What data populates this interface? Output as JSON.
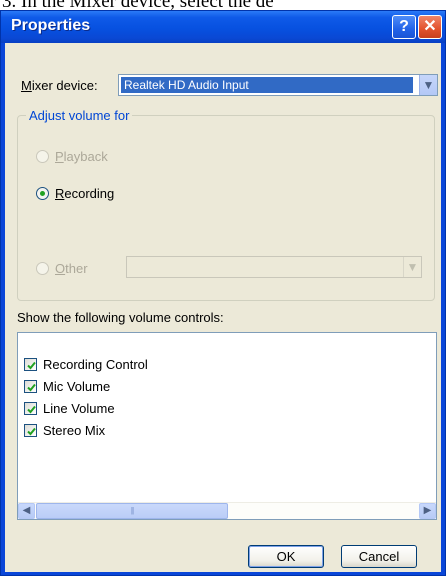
{
  "document": {
    "caption": "3. In the Mixer device, select the de"
  },
  "window": {
    "title": "Properties",
    "help_glyph": "?",
    "close_glyph": "✕"
  },
  "mixer": {
    "label_accel": "M",
    "label_rest": "ixer device:",
    "value": "Realtek HD Audio Input"
  },
  "adjust_group": {
    "legend": "Adjust volume for",
    "options": [
      {
        "accel": "P",
        "rest": "layback",
        "enabled": false,
        "selected": false
      },
      {
        "accel": "R",
        "rest": "ecording",
        "enabled": true,
        "selected": true
      },
      {
        "accel": "O",
        "rest": "ther",
        "enabled": false,
        "selected": false
      }
    ],
    "other_value": ""
  },
  "controls": {
    "label": "Show the following volume controls:",
    "items": [
      {
        "label": "Recording Control",
        "checked": true
      },
      {
        "label": "Mic Volume",
        "checked": true
      },
      {
        "label": "Line Volume",
        "checked": true
      },
      {
        "label": "Stereo Mix",
        "checked": true
      }
    ],
    "scrollbar": {
      "thumb_grip": "|||"
    }
  },
  "buttons": {
    "ok": "OK",
    "cancel": "Cancel"
  },
  "colors": {
    "title_bar": "#0751e0",
    "dialog_face": "#ece9d8",
    "selection": "#316ac5",
    "legend_text": "#0046d5",
    "radio_dot": "#21a121",
    "check_mark": "#21a121"
  },
  "icons": {
    "help": "help-icon",
    "close": "close-icon",
    "dropdown": "chevron-down-icon",
    "scroll_left": "arrow-left-icon",
    "scroll_right": "arrow-right-icon",
    "check": "checkmark-icon"
  }
}
